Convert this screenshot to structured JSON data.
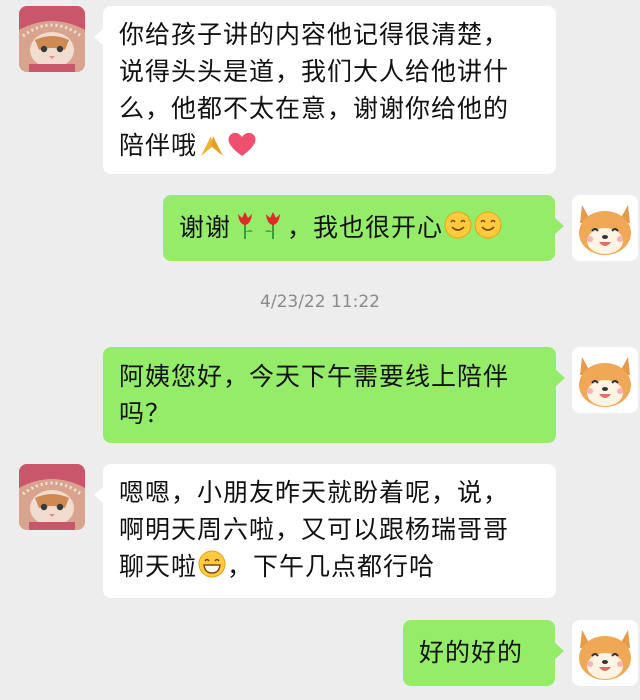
{
  "messages": [
    {
      "side": "incoming",
      "avatar": "cat-avatar",
      "lines": [
        "你给孩子讲的内容他记得很清楚，",
        "说得头头是道，我们大人给他讲什",
        "么，他都不太在意，谢谢你给他的",
        "陪伴哦"
      ],
      "emojis": [
        "folded-hands-emoji",
        "heart-emoji"
      ]
    },
    {
      "side": "outgoing",
      "avatar": "shiba-avatar",
      "text_a": "谢谢",
      "text_b": "，我也很开心",
      "emojis": [
        "tulip-emoji",
        "tulip-emoji",
        "smiling-face-emoji",
        "smiling-face-emoji"
      ]
    },
    {
      "side": "outgoing",
      "avatar": "shiba-avatar",
      "lines": [
        "阿姨您好，今天下午需要线上陪伴",
        "吗？"
      ]
    },
    {
      "side": "incoming",
      "avatar": "cat-avatar",
      "lines": [
        "嗯嗯，小朋友昨天就盼着呢，说，",
        "啊明天周六啦，又可以跟杨瑞哥哥",
        "聊天啦"
      ],
      "line3_tail": "，下午几点都行哈",
      "emojis": [
        "grinning-face-emoji"
      ]
    },
    {
      "side": "outgoing",
      "avatar": "shiba-avatar",
      "text": "好的好的"
    }
  ],
  "timestamp": "4/23/22 11:22",
  "colors": {
    "background": "#ededed",
    "incoming_bubble": "#ffffff",
    "outgoing_bubble": "#95ec69",
    "timestamp_text": "#8a8a8a"
  }
}
